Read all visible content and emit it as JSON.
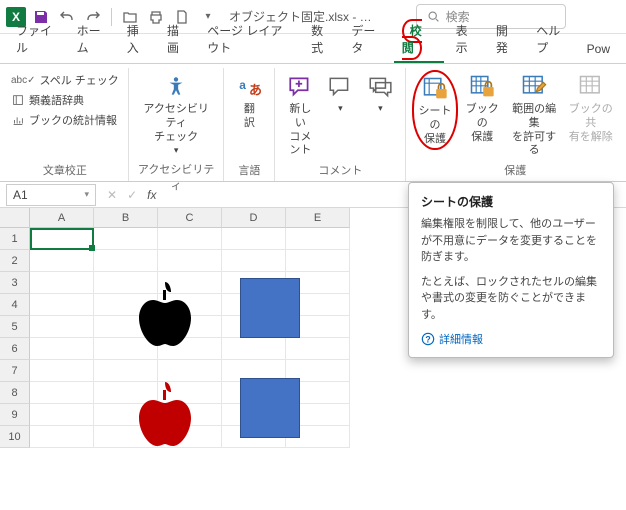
{
  "titlebar": {
    "filename": "オブジェクト固定.xlsx - …",
    "search_placeholder": "検索"
  },
  "tabs": {
    "file": "ファイル",
    "home": "ホーム",
    "insert": "挿入",
    "draw": "描画",
    "layout": "ページ レイアウト",
    "formula": "数式",
    "data": "データ",
    "review": "校閲",
    "view": "表示",
    "developer": "開発",
    "help": "ヘルプ",
    "pow": "Pow"
  },
  "ribbon": {
    "proofing": {
      "label": "文章校正",
      "spell": "スペル チェック",
      "thesaurus": "類義語辞典",
      "stats": "ブックの統計情報"
    },
    "access": {
      "label": "アクセシビリティ",
      "btn": "アクセシビリティ\nチェック"
    },
    "lang": {
      "label": "言語",
      "btn": "翻\n訳"
    },
    "comment": {
      "label": "コメント",
      "btn": "新しい\nコメント"
    },
    "protect": {
      "label": "保護",
      "sheet": "シートの\n保護",
      "book": "ブックの\n保護",
      "range": "範囲の編集\nを許可する",
      "unshare": "ブックの共\n有を解除"
    }
  },
  "namebox": {
    "value": "A1"
  },
  "cols": [
    "A",
    "B",
    "C",
    "D",
    "E"
  ],
  "rows": [
    "1",
    "2",
    "3",
    "4",
    "5",
    "6",
    "7",
    "8",
    "9",
    "10"
  ],
  "tooltip": {
    "title": "シートの保護",
    "body1": "編集権限を制限して、他のユーザーが不用意にデータを変更することを防ぎます。",
    "body2": "たとえば、ロックされたセルの編集や書式の変更を防ぐことができます。",
    "more": "詳細情報"
  }
}
